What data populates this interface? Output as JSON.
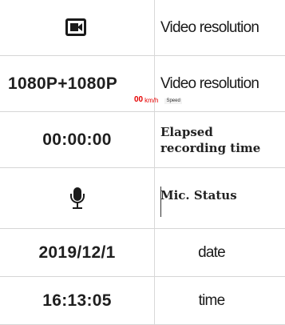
{
  "rows": [
    {
      "icon": "video-camera-icon",
      "right": "Video resolution"
    },
    {
      "left": "1080P+1080P",
      "right": "Video resolution"
    },
    {
      "left": "00:00:00",
      "right_line1": "Elapsed",
      "right_line2": "recording time"
    },
    {
      "icon": "microphone-icon",
      "right": "Mic. Status"
    },
    {
      "left": "2019/12/1",
      "right": "date"
    },
    {
      "left": "16:13:05",
      "right": "time"
    }
  ],
  "overlay": {
    "number": "00",
    "unit": "km/h",
    "speed_label": "Speed"
  },
  "colors": {
    "speed_number": "#e60000",
    "text": "#1a1a1a",
    "divider": "#d9d9d9"
  }
}
